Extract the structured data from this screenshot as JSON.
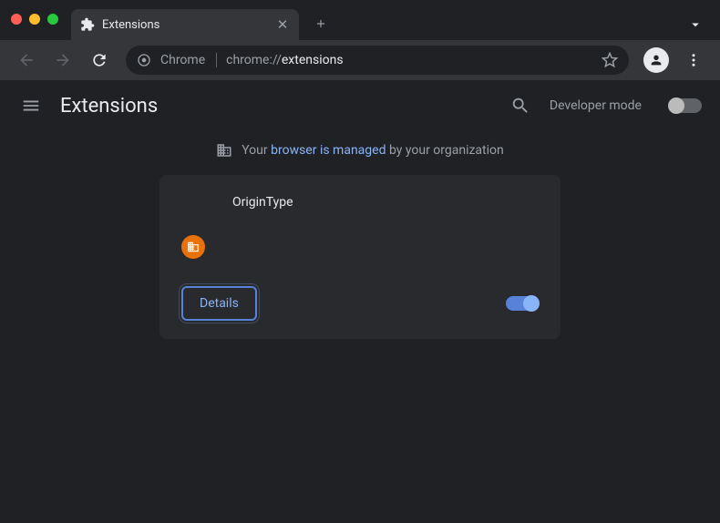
{
  "tab": {
    "title": "Extensions",
    "icon": "puzzle"
  },
  "toolbar": {
    "chrome_label": "Chrome",
    "url_prefix": "chrome://",
    "url_bold": "extensions"
  },
  "header": {
    "title": "Extensions",
    "dev_mode_label": "Developer mode",
    "dev_mode_on": false
  },
  "banner": {
    "prefix": "Your ",
    "link": "browser is managed",
    "suffix": " by your organization"
  },
  "extension": {
    "name": "OriginType",
    "details_label": "Details",
    "enabled": true,
    "managed": true
  }
}
